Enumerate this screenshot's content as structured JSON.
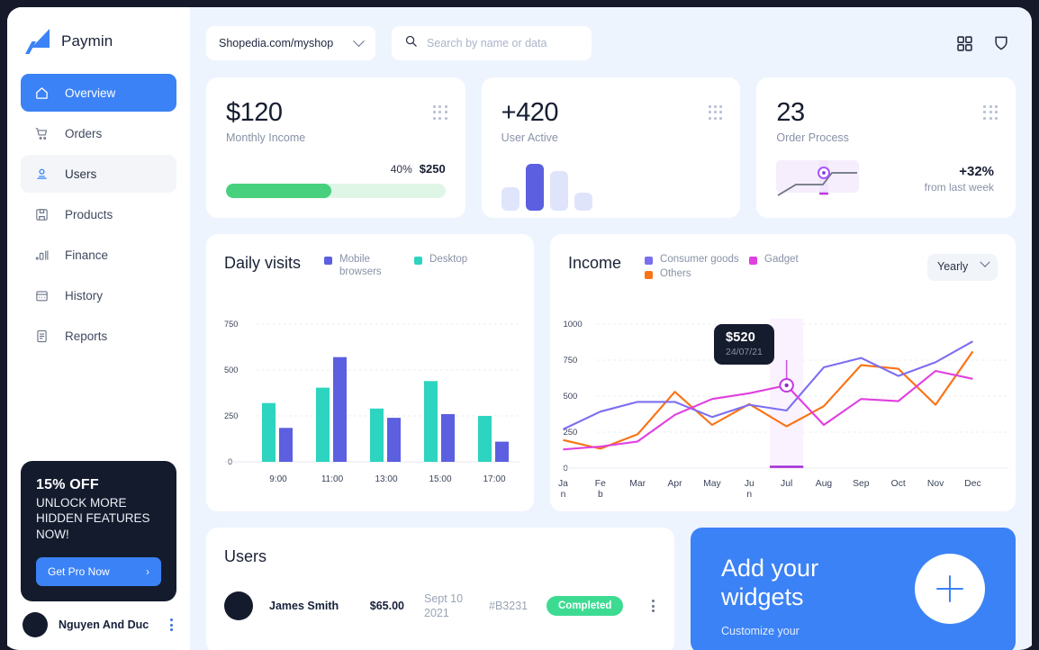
{
  "brand": {
    "name": "Paymin",
    "logo_icon": "paymin-logo-icon"
  },
  "sidebar": {
    "items": [
      {
        "label": "Overview",
        "icon": "home-icon",
        "state": "active"
      },
      {
        "label": "Orders",
        "icon": "cart-icon",
        "state": "default"
      },
      {
        "label": "Users",
        "icon": "user-icon",
        "state": "hover"
      },
      {
        "label": "Products",
        "icon": "package-icon",
        "state": "default"
      },
      {
        "label": "Finance",
        "icon": "bar-chart-icon",
        "state": "default"
      },
      {
        "label": "History",
        "icon": "calendar-icon",
        "state": "default"
      },
      {
        "label": "Reports",
        "icon": "document-icon",
        "state": "default"
      }
    ],
    "promo": {
      "headline": "15% OFF",
      "subline": "UNLOCK MORE HIDDEN FEATURES NOW!",
      "button": "Get Pro Now",
      "button_icon": "chevron-right-icon"
    },
    "account": {
      "name": "Nguyen And Duc",
      "menu_icon": "kebab-menu-icon"
    }
  },
  "topbar": {
    "shop": "Shopedia.com/myshop",
    "shop_chevron_icon": "chevron-down-icon",
    "search_placeholder": "Search by name or data",
    "search_value": "",
    "search_icon": "search-icon",
    "apps_icon": "grid-apps-icon",
    "shield_icon": "shield-icon"
  },
  "stats": [
    {
      "value": "$120",
      "label": "Monthly Income",
      "menu_icon": "drag-dots-icon",
      "progress": {
        "percent_label": "40%",
        "amount_label": "$250",
        "fill_percent": 48,
        "color": "#47d07e",
        "track_color": "#dff6e7"
      }
    },
    {
      "value": "+420",
      "label": "User Active",
      "menu_icon": "drag-dots-icon",
      "bars": [
        {
          "height": 26,
          "color": "#e0e5fc"
        },
        {
          "height": 52,
          "color": "#5b5fe0"
        },
        {
          "height": 44,
          "color": "#dfe4fb"
        },
        {
          "height": 20,
          "color": "#dfe4fb"
        }
      ]
    },
    {
      "value": "23",
      "label": "Order Process",
      "menu_icon": "drag-dots-icon",
      "delta": "+32%",
      "delta_sub": "from last week",
      "spark_color": "#6b7280",
      "marker_color": "#a855f7"
    }
  ],
  "chart_data": [
    {
      "type": "bar",
      "title": "Daily visits",
      "categories": [
        "9:00",
        "11:00",
        "13:00",
        "15:00",
        "17:00"
      ],
      "series": [
        {
          "name": "Desktop",
          "color": "#2dd4bf",
          "values": [
            325,
            410,
            295,
            440,
            250
          ]
        },
        {
          "name": "Mobile browsers",
          "color": "#5b5fe0",
          "values": [
            185,
            570,
            240,
            260,
            110
          ]
        }
      ],
      "legend": [
        {
          "label": "Mobile browsers",
          "color": "#5b5fe0"
        },
        {
          "label": "Desktop",
          "color": "#2dd4bf"
        }
      ],
      "yticks": [
        0,
        250,
        500,
        750
      ],
      "ylim": [
        0,
        800
      ],
      "xlabel": "",
      "ylabel": "",
      "grid": true,
      "legend_position": "top-right"
    },
    {
      "type": "line",
      "title": "Income",
      "period": "Yearly",
      "period_chevron_icon": "chevron-down-icon",
      "x": [
        "Jan",
        "Feb",
        "Mar",
        "Apr",
        "May",
        "Jun",
        "Jul",
        "Aug",
        "Sep",
        "Oct",
        "Nov",
        "Dec"
      ],
      "series": [
        {
          "name": "Consumer goods",
          "color": "#7c6ef0",
          "values": [
            270,
            395,
            460,
            460,
            355,
            440,
            400,
            700,
            765,
            640,
            735,
            880
          ]
        },
        {
          "name": "Gadget",
          "color": "#e040e0",
          "values": [
            130,
            150,
            185,
            370,
            480,
            520,
            575,
            300,
            480,
            465,
            675,
            620
          ]
        },
        {
          "name": "Others",
          "color": "#f97316",
          "values": [
            195,
            135,
            240,
            530,
            300,
            445,
            290,
            430,
            715,
            690,
            440,
            810
          ]
        }
      ],
      "legend": [
        {
          "label": "Consumer goods",
          "color": "#7c6ef0"
        },
        {
          "label": "Gadget",
          "color": "#e040e0"
        },
        {
          "label": "Others",
          "color": "#f97316"
        }
      ],
      "yticks": [
        0,
        250,
        500,
        750,
        1000
      ],
      "ylim": [
        0,
        1050
      ],
      "tooltip": {
        "value": "$520",
        "date": "24/07/21",
        "at_category": "Jul"
      },
      "xlabel": "",
      "ylabel": "",
      "grid": true,
      "legend_position": "top-left"
    }
  ],
  "users_panel": {
    "title": "Users",
    "rows": [
      {
        "name": "James Smith",
        "amount": "$65.00",
        "date": "Sept 10 2021",
        "order_id": "#B3231",
        "status": "Completed",
        "status_color": "#3ddb92",
        "menu_icon": "kebab-menu-icon"
      }
    ]
  },
  "widget_card": {
    "title": "Add your widgets",
    "subtitle": "Customize your",
    "add_icon": "plus-icon",
    "color": "#3b82f6"
  }
}
